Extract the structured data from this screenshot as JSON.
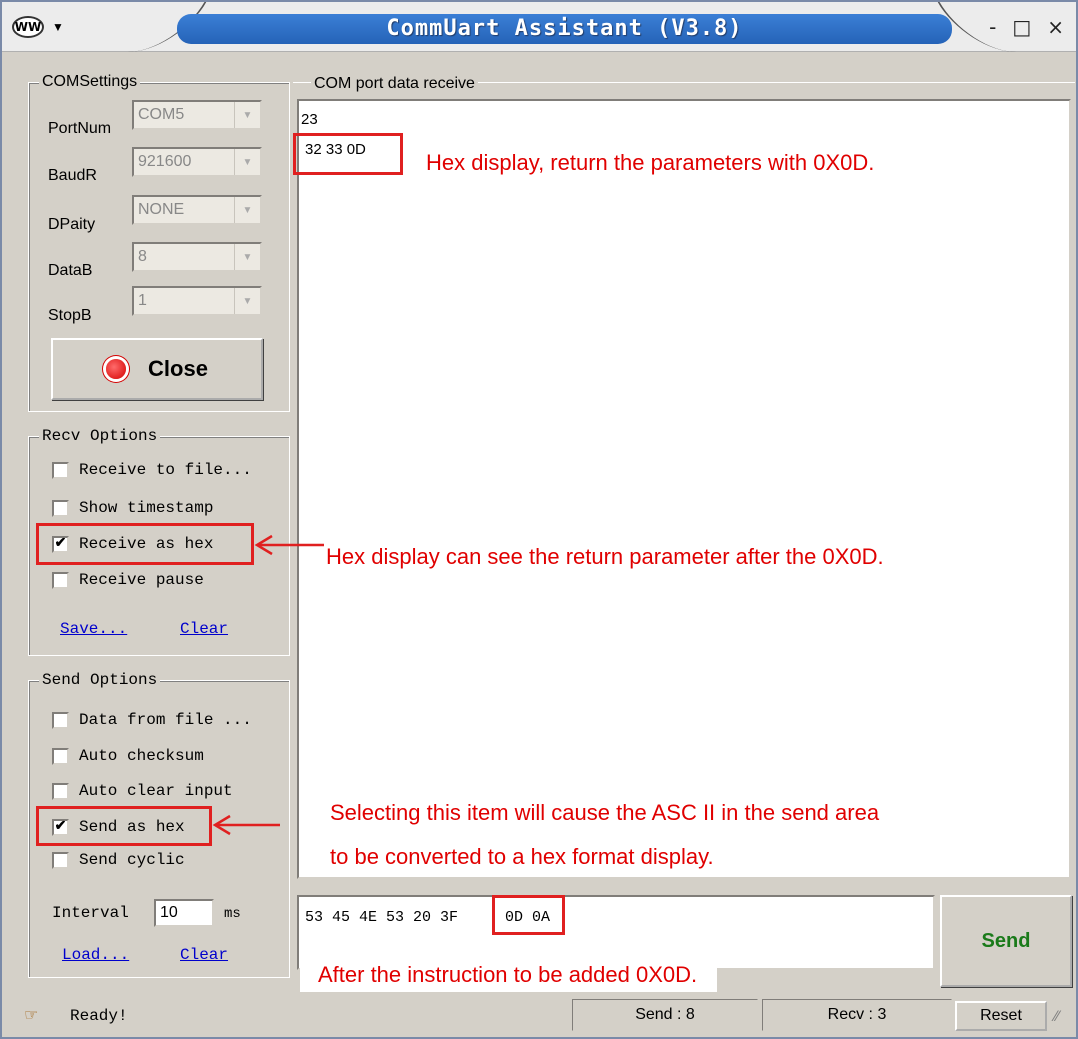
{
  "title": "CommUart Assistant (V3.8)",
  "window_buttons": {
    "minimize": "-",
    "maximize": "□",
    "close": "×"
  },
  "com_settings": {
    "label": "COMSettings",
    "port_label": "PortNum",
    "port_value": "COM5",
    "baud_label": "BaudR",
    "baud_value": "921600",
    "parity_label": "DPaity",
    "parity_value": "NONE",
    "data_label": "DataB",
    "data_value": "8",
    "stop_label": "StopB",
    "stop_value": "1",
    "close_button": "Close"
  },
  "recv_options": {
    "label": "Recv Options",
    "items": [
      {
        "label": "Receive to file...",
        "checked": false
      },
      {
        "label": "Show timestamp",
        "checked": false
      },
      {
        "label": "Receive as hex",
        "checked": true
      },
      {
        "label": "Receive pause",
        "checked": false
      }
    ],
    "save_link": "Save...",
    "clear_link": "Clear"
  },
  "send_options": {
    "label": "Send Options",
    "items": [
      {
        "label": "Data from file ...",
        "checked": false
      },
      {
        "label": "Auto checksum",
        "checked": false
      },
      {
        "label": "Auto clear input",
        "checked": false
      },
      {
        "label": "Send as hex",
        "checked": true
      },
      {
        "label": "Send cyclic",
        "checked": false
      }
    ],
    "interval_label": "Interval",
    "interval_value": "10",
    "interval_unit": "ms",
    "load_link": "Load...",
    "clear_link": "Clear"
  },
  "receive": {
    "label": "COM port data receive",
    "lines": [
      "23",
      "32 33 0D"
    ]
  },
  "send": {
    "input_value": "53 45 4E 53 20 3F",
    "input_suffix": "0D 0A",
    "button": "Send"
  },
  "annotations": {
    "hex_return": "Hex display, return the parameters with 0X0D.",
    "hex_after": "Hex display can see the return parameter after the 0X0D.",
    "send_hex_1": "Selecting this item will cause the ASC II in the send area",
    "send_hex_2": "to be converted to a hex format display.",
    "added": "After the instruction to be added 0X0D."
  },
  "status": {
    "ready": "Ready!",
    "send_count": "Send : 8",
    "recv_count": "Recv : 3",
    "reset": "Reset"
  }
}
